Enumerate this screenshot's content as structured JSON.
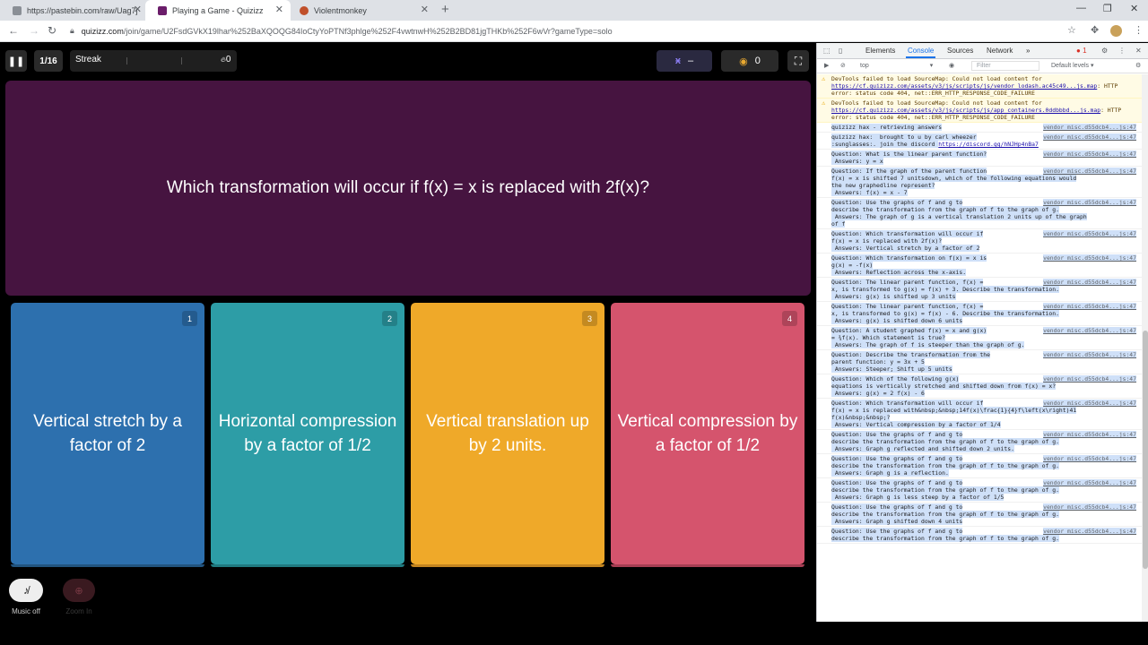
{
  "browser": {
    "tabs": [
      {
        "title": "https://pastebin.com/raw/Uag7j",
        "favicon_color": "#8a8f96"
      },
      {
        "title": "Playing a Game - Quizizz",
        "favicon_color": "#6b1d6a",
        "active": true
      },
      {
        "title": "Violentmonkey",
        "favicon_color": "#c0502b"
      }
    ],
    "close_glyph": "✕",
    "new_tab_glyph": "+",
    "url_host": "quizizz.com",
    "url_path": "/join/game/U2FsdGVkX19lhar%252BaXQOQG84IoCtyYoPTNf3phlge%252F4vwtnwH%252B2BD81jgTHKb%252F6wVr?gameType=solo",
    "window_controls": [
      "—",
      "❐",
      "✕"
    ]
  },
  "game": {
    "pause_icon": "❚❚",
    "question_counter": "1/16",
    "streak_label": "Streak",
    "streak_count": "0",
    "powerup_value": "–",
    "coins_value": "0",
    "question_text": "Which transformation will occur if f(x) = x is replaced with 2f(x)?",
    "options": [
      {
        "number": "1",
        "text": "Vertical stretch by a factor of 2",
        "color": "#2d70ae"
      },
      {
        "number": "2",
        "text": "Horizontal compression by a factor of 1/2",
        "color": "#2d9da6"
      },
      {
        "number": "3",
        "text": "Vertical translation up by 2 units.",
        "color": "#efa929"
      },
      {
        "number": "4",
        "text": "Vertical compression by a factor of 1/2",
        "color": "#d5546d"
      }
    ],
    "music_label": "Music off",
    "zoom_label": "Zoom In"
  },
  "devtools": {
    "tabs": [
      "Elements",
      "Console",
      "Sources",
      "Network"
    ],
    "active_tab": "Console",
    "more_tabs": "»",
    "error_count": "1",
    "context": "top",
    "filter_placeholder": "Filter",
    "levels": "Default levels ▾",
    "messages": [
      {
        "type": "warn",
        "text": "DevTools failed to load SourceMap: Could not load content for ",
        "link": "https://cf.quizizz.com/assets/v3/js/scripts/js/vendor_lodash.ac45c49...js.map",
        "rest": ": HTTP error: status code 404, net::ERR_HTTP_RESPONSE_CODE_FAILURE"
      },
      {
        "type": "warn",
        "text": "DevTools failed to load SourceMap: Could not load content for ",
        "link": "https://cf.quizizz.com/assets/v3/js/scripts/js/app_containers.0ddbbbd...js.map",
        "rest": ": HTTP error: status code 404, net::ERR_HTTP_RESPONSE_CODE_FAILURE"
      },
      {
        "type": "log",
        "text": "quizizz hax - retrieving answers",
        "src": "vendor_misc.d55dcb4...js:47"
      },
      {
        "type": "log",
        "text": "quizizz hax:  brought to u by carl wheezer\n:sunglasses:. join the discord ",
        "link": "https://discord.gg/hNJHp4nBa7",
        "src": "vendor_misc.d55dcb4...js:47"
      },
      {
        "type": "log",
        "text": "Question: What is the linear parent function?\n Answers: y = x",
        "src": "vendor_misc.d55dcb4...js:47"
      },
      {
        "type": "log",
        "text": "Question: If the graph of the parent function\nf(x) = x is shifted 7 unitsdown, which of the following equations would\nthe new graphedline represent?\n Answers: f(x) = x - 7",
        "src": "vendor_misc.d55dcb4...js:47"
      },
      {
        "type": "log",
        "text": "Question: Use the graphs of f and g to\ndescribe the transformation from the graph of f to the graph of g.\n Answers: The graph of g is a vertical translation 2 units up of the graph\nof f",
        "src": "vendor_misc.d55dcb4...js:47"
      },
      {
        "type": "log",
        "text": "Question: Which transformation will occur if\nf(x) = x is replaced with 2f(x)?\n Answers: Vertical stretch by a factor of 2",
        "src": "vendor_misc.d55dcb4...js:47"
      },
      {
        "type": "log",
        "text": "Question: Which transformation on f(x) = x is\ng(x) = -f(x)\n Answers: Reflection across the x-axis.",
        "src": "vendor_misc.d55dcb4...js:47"
      },
      {
        "type": "log",
        "text": "Question: The linear parent function, f(x) =\nx, is transformed to g(x) = f(x) + 3. Describe the transformation.\n Answers: g(x) is shifted up 3 units",
        "src": "vendor_misc.d55dcb4...js:47"
      },
      {
        "type": "log",
        "text": "Question: The linear parent function, f(x) =\nx, is transformed to g(x) = f(x) - 6. Describe the transformation.\n Answers: g(x) is shifted down 6 units",
        "src": "vendor_misc.d55dcb4...js:47"
      },
      {
        "type": "log",
        "text": "Question: A student graphed f(x) = x and g(x)\n= ¾f(x). Which statement is true?\n Answers: The graph of f is steeper than the graph of g.",
        "src": "vendor_misc.d55dcb4...js:47"
      },
      {
        "type": "log",
        "text": "Question: Describe the transformation from the\nparent function: y = 3x + 5\n Answers: Steeper; Shift up 5 units",
        "src": "vendor_misc.d55dcb4...js:47"
      },
      {
        "type": "log",
        "text": "Question: Which of the following g(x)\nequations is vertically stretched and shifted down from f(x) = x?\n Answers: g(x) = 2 f(x) - 6",
        "src": "vendor_misc.d55dcb4...js:47"
      },
      {
        "type": "log",
        "text": "Question: Which transformation will occur if\nf(x) = x is replaced with&nbsp;&nbsp;14f(x)\\frac{1}{4}f\\left(x\\right)41\nf(x)&nbsp;&nbsp;?\n Answers: Vertical compression by a factor of 1/4",
        "src": "vendor_misc.d55dcb4...js:47"
      },
      {
        "type": "log",
        "text": "Question: Use the graphs of f and g to\ndescribe the transformation from the graph of f to the graph of g.\n Answers: Graph g reflected and shifted down 2 units.",
        "src": "vendor_misc.d55dcb4...js:47"
      },
      {
        "type": "log",
        "text": "Question: Use the graphs of f and g to\ndescribe the transformation from the graph of f to the graph of g.\n Answers: Graph g is a reflection.",
        "src": "vendor_misc.d55dcb4...js:47"
      },
      {
        "type": "log",
        "text": "Question: Use the graphs of f and g to\ndescribe the transformation from the graph of f to the graph of g.\n Answers: Graph g is less steep by a factor of 1/5",
        "src": "vendor_misc.d55dcb4...js:47"
      },
      {
        "type": "log",
        "text": "Question: Use the graphs of f and g to\ndescribe the transformation from the graph of f to the graph of g.\n Answers: Graph g shifted down 4 units",
        "src": "vendor_misc.d55dcb4...js:47"
      },
      {
        "type": "log",
        "text": "Question: Use the graphs of f and g to\ndescribe the transformation from the graph of f to the graph of g.",
        "src": "vendor_misc.d55dcb4...js:47"
      }
    ]
  }
}
